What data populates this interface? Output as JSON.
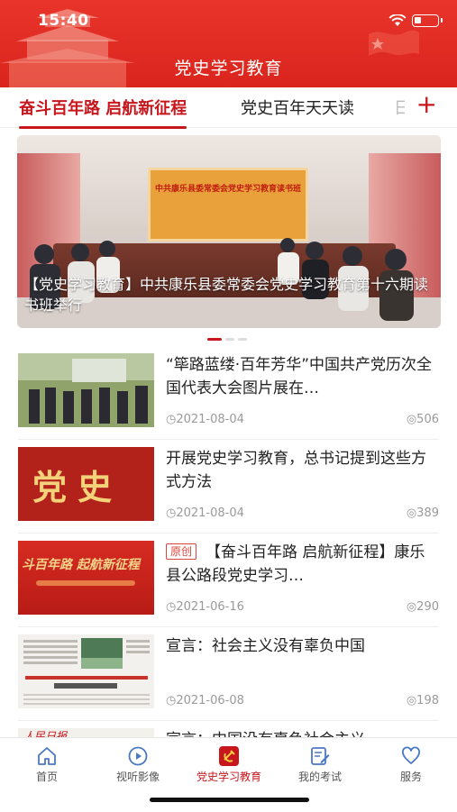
{
  "status_bar": {
    "time": "15:40"
  },
  "header": {
    "title": "党史学习教育"
  },
  "tabs": [
    {
      "label": "奋斗百年路 启航新征程",
      "active": true
    },
    {
      "label": "党史百年天天读",
      "active": false
    },
    {
      "label": "日",
      "active": false
    }
  ],
  "add_tab_icon": "plus-icon",
  "banner": {
    "caption": "【党史学习教育】中共康乐县委常委会党史学习教育第十六期读书班举行",
    "screen_text": "中共康乐县委常委会党史学习教育读书班",
    "carousel_dots": 3,
    "active_dot": 0
  },
  "news": [
    {
      "title": "“筚路蓝缕·百年芳华”中国共产党历次全国代表大会图片展在…",
      "date": "2021-08-04",
      "views": "506",
      "badge": ""
    },
    {
      "title": "开展党史学习教育，总书记提到这些方式方法",
      "date": "2021-08-04",
      "views": "389",
      "badge": "",
      "thumb_text": "党史"
    },
    {
      "title": "【奋斗百年路 启航新征程】康乐县公路段党史学习…",
      "date": "2021-06-16",
      "views": "290",
      "badge": "原创",
      "thumb_text": "斗百年路 起航新征程"
    },
    {
      "title": "宣言：社会主义没有辜负中国",
      "date": "2021-06-08",
      "views": "198",
      "badge": ""
    },
    {
      "title": "宣言：中国没有辜负社会主义",
      "date": "",
      "views": "",
      "badge": "",
      "thumb_text": "人民日报"
    }
  ],
  "bottom_nav": [
    {
      "label": "首页",
      "icon": "home-icon",
      "active": false
    },
    {
      "label": "视听影像",
      "icon": "play-circle-icon",
      "active": false
    },
    {
      "label": "党史学习教育",
      "icon": "party-emblem-icon",
      "active": true
    },
    {
      "label": "我的考试",
      "icon": "exam-edit-icon",
      "active": false
    },
    {
      "label": "服务",
      "icon": "heart-icon",
      "active": false
    }
  ],
  "colors": {
    "brand_red": "#c8161d",
    "header_red": "#e02d24",
    "muted": "#999999"
  }
}
